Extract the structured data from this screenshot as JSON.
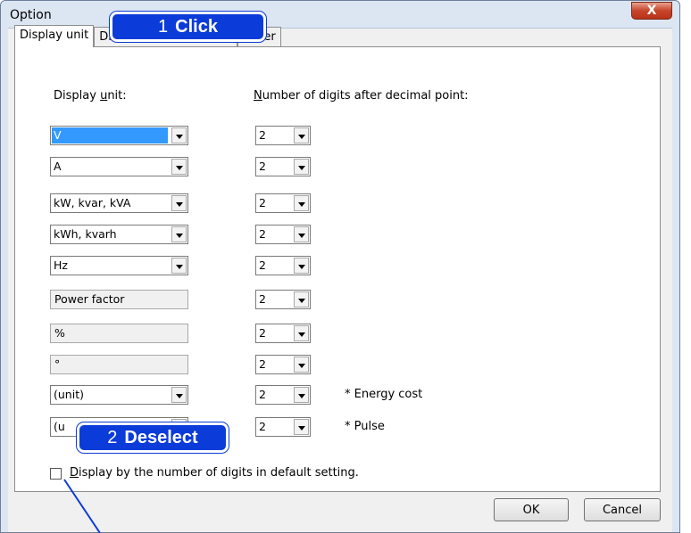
{
  "window": {
    "title": "Option",
    "close_label": "X"
  },
  "tabs": [
    {
      "label": "Display unit"
    },
    {
      "label": "Divided by time period"
    },
    {
      "label": "Other"
    }
  ],
  "headers": {
    "unit_prefix": "Display ",
    "unit_u": "u",
    "unit_suffix": "nit:",
    "digits_u": "N",
    "digits_suffix": "umber of digits after decimal point:"
  },
  "rows": [
    {
      "unit": "V",
      "type": "combo",
      "digits": "2",
      "note": ""
    },
    {
      "unit": "A",
      "type": "combo",
      "digits": "2",
      "note": ""
    },
    {
      "unit": "kW, kvar, kVA",
      "type": "combo",
      "digits": "2",
      "note": ""
    },
    {
      "unit": "kWh, kvarh",
      "type": "combo",
      "digits": "2",
      "note": ""
    },
    {
      "unit": "Hz",
      "type": "combo",
      "digits": "2",
      "note": ""
    },
    {
      "unit": "Power factor",
      "type": "text",
      "digits": "2",
      "note": ""
    },
    {
      "unit": "%",
      "type": "text",
      "digits": "2",
      "note": ""
    },
    {
      "unit": "°",
      "type": "text",
      "digits": "2",
      "note": ""
    },
    {
      "unit": "(unit)",
      "type": "combo",
      "digits": "2",
      "note": "* Energy cost"
    },
    {
      "unit": "(u",
      "type": "combo",
      "digits": "2",
      "note": "* Pulse"
    }
  ],
  "checkbox": {
    "checked": false,
    "label_u": "D",
    "label_rest": "isplay by the number of digits in default setting."
  },
  "buttons": {
    "ok": "OK",
    "cancel": "Cancel"
  },
  "callouts": {
    "step1_num": "1",
    "step1_text": "Click",
    "step2_num": "2",
    "step2_text": "Deselect"
  },
  "colors": {
    "callout": "#0b3bd8",
    "selection": "#3399ff"
  }
}
